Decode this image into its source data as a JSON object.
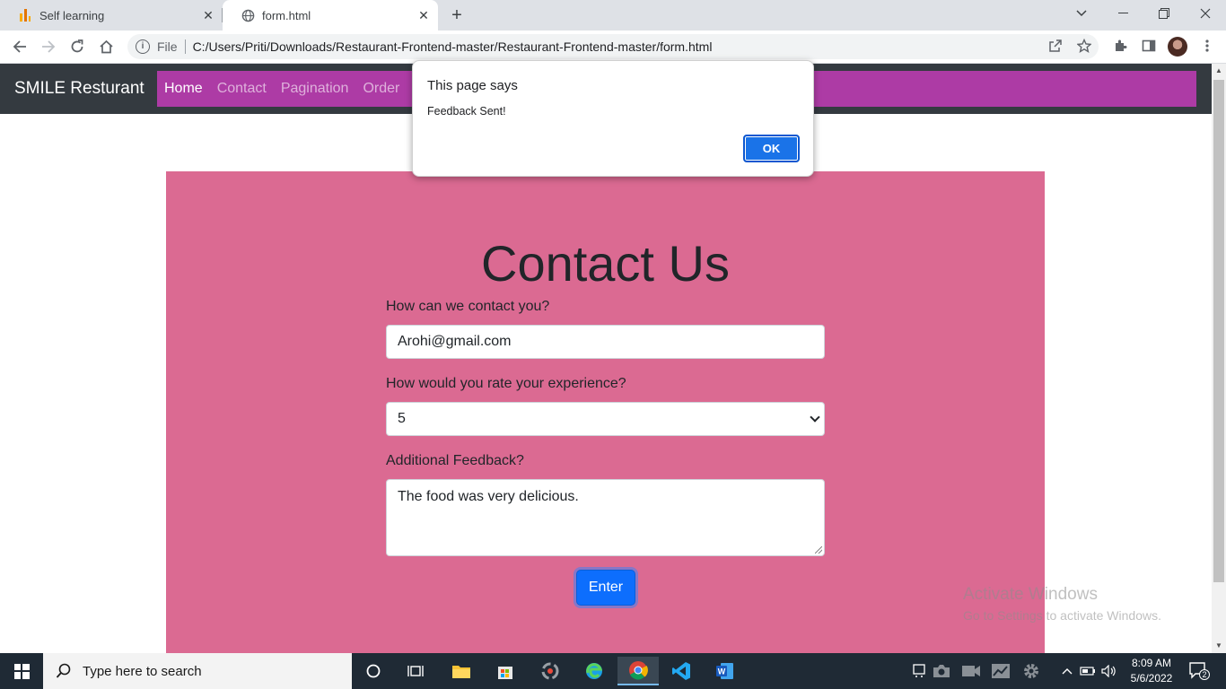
{
  "browser": {
    "tabs": [
      {
        "title": "Self learning",
        "active": false
      },
      {
        "title": "form.html",
        "active": true
      }
    ],
    "address": {
      "scheme_label": "File",
      "url": "C:/Users/Priti/Downloads/Restaurant-Frontend-master/Restaurant-Frontend-master/form.html"
    }
  },
  "navbar": {
    "brand": "SMILE Resturant",
    "links": [
      "Home",
      "Contact",
      "Pagination",
      "Order"
    ],
    "active_link": "Home",
    "link_bg_color": "#ad3ba5"
  },
  "form": {
    "title": "Contact Us",
    "contact_label": "How can we contact you?",
    "contact_value": "Arohi@gmail.com",
    "rating_label": "How would you rate your experience?",
    "rating_value": "5",
    "feedback_label": "Additional Feedback?",
    "feedback_value": "The food was very delicious.",
    "submit_label": "Enter",
    "panel_color": "#db6a92"
  },
  "dialog": {
    "title": "This page says",
    "message": "Feedback Sent!",
    "ok_label": "OK"
  },
  "watermark": {
    "line1": "Activate Windows",
    "line2": "Go to Settings to activate Windows."
  },
  "taskbar": {
    "search_placeholder": "Type here to search",
    "time": "8:09 AM",
    "date": "5/6/2022",
    "notification_count": "2"
  }
}
